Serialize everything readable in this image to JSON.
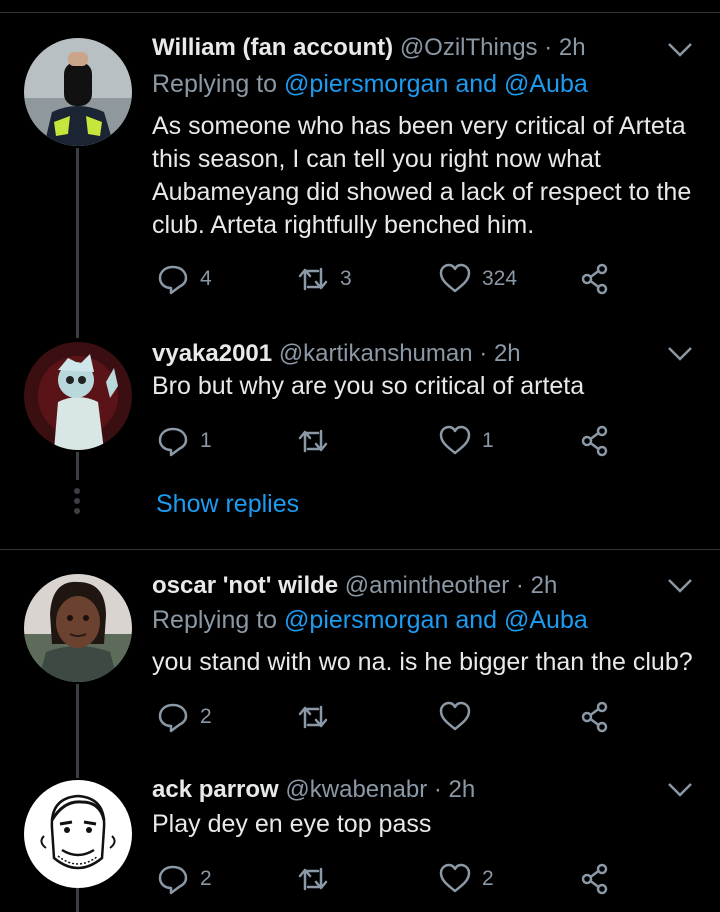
{
  "tweets": [
    {
      "name": "William (fan account)",
      "handle": "@OzilThings",
      "time": "2h",
      "replying_prefix": "Replying to",
      "mention1": "@piersmorgan",
      "and": "and",
      "mention2": "@Auba",
      "text": "As someone who has been very critical of Arteta this season, I can tell you right now what Aubameyang did showed a lack of respect to the club. Arteta rightfully benched him.",
      "replies": "4",
      "retweets": "3",
      "likes": "324"
    },
    {
      "name": "vyaka2001",
      "handle": "@kartikanshuman",
      "time": "2h",
      "text": "Bro but why are you so critical of arteta",
      "replies": "1",
      "retweets": "",
      "likes": "1"
    },
    {
      "name": "oscar 'not' wilde",
      "handle": "@amintheother",
      "time": "2h",
      "replying_prefix": "Replying to",
      "mention1": "@piersmorgan",
      "and": "and",
      "mention2": "@Auba",
      "text": "you stand with wo na. is he bigger than the club?",
      "replies": "2",
      "retweets": "",
      "likes": ""
    },
    {
      "name": "ack parrow",
      "handle": "@kwabenabr",
      "time": "2h",
      "text": "Play dey en eye top pass",
      "replies": "2",
      "retweets": "",
      "likes": "2"
    }
  ],
  "show_replies": "Show replies",
  "separator": "·",
  "icons": [
    "reply-icon",
    "retweet-icon",
    "like-icon",
    "share-icon",
    "chevron-down-icon"
  ],
  "colors": {
    "background": "#000000",
    "text": "#e7e9ea",
    "muted": "#8b98a5",
    "accent": "#1d9bf0",
    "divider": "#2f3336"
  }
}
